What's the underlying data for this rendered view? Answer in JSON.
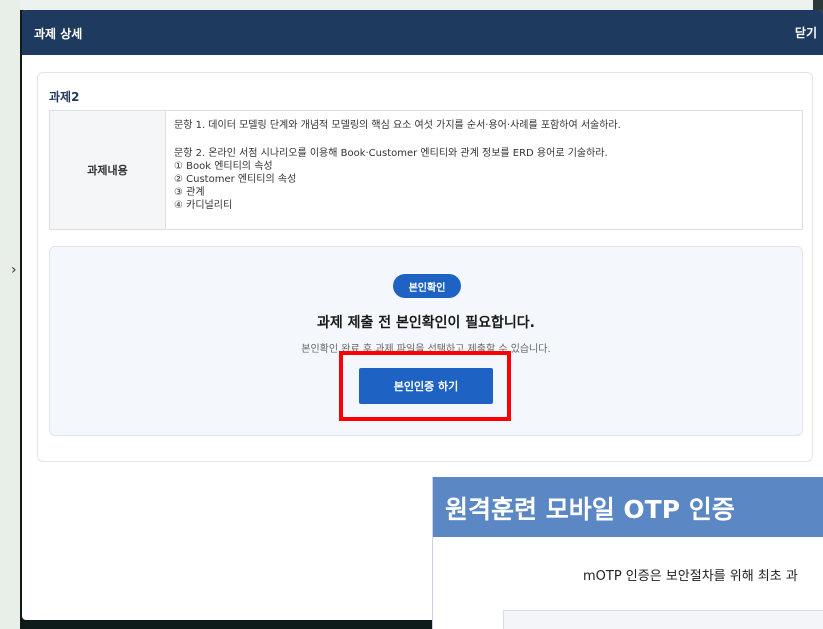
{
  "modal": {
    "title": "과제 상세",
    "close_label": "닫기"
  },
  "assignment": {
    "name": "과제2",
    "content_header": "과제내용",
    "lines": [
      "문항 1. 데이터 모델링 단계와 개념적 모델링의 핵심 요소 여섯 가지를 순서·용어·사례를 포함하여 서술하라.",
      "문항 2. 온라인 서점 시나리오를 이용해 Book·Customer 엔티티와 관계 정보를 ERD 용어로 기술하라.",
      "① Book 엔티티의 속성",
      "② Customer 엔티티의 속성",
      "③ 관계",
      "④ 카디널리티"
    ]
  },
  "verification": {
    "badge": "본인확인",
    "heading": "과제 제출 전 본인확인이 필요합니다.",
    "subtext": "본인확인 완료 후 과제 파일을 선택하고 제출할 수 있습니다.",
    "button_label": "본인인증 하기"
  },
  "otp_popup": {
    "title": "원격훈련 모바일 OTP 인증",
    "description": "mOTP 인증은 보안절차를 위해 최초 과"
  },
  "colors": {
    "header_bg": "#1e3a5f",
    "accent": "#1e63c4",
    "highlight": "#ff0000",
    "otp_header": "#5b87c5"
  }
}
